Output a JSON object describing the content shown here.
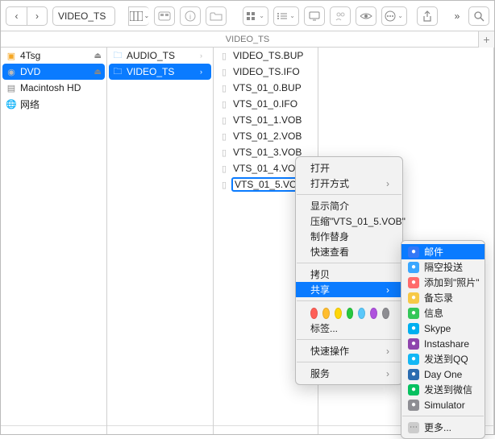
{
  "window_title": "VIDEO_TS",
  "path_title": "VIDEO_TS",
  "toolbar": {
    "back": "‹",
    "forward": "›",
    "more": "»"
  },
  "sidebar": {
    "items": [
      {
        "label": "4Tsg",
        "icon": "orange",
        "eject": true
      },
      {
        "label": "DVD",
        "icon": "disc",
        "eject": true,
        "selected": true
      },
      {
        "label": "Macintosh HD",
        "icon": "hd",
        "eject": false
      },
      {
        "label": "网络",
        "icon": "network",
        "eject": false
      }
    ]
  },
  "col2": {
    "items": [
      {
        "label": "AUDIO_TS",
        "folder": true,
        "disclosure": true
      },
      {
        "label": "VIDEO_TS",
        "folder": true,
        "disclosure": true,
        "selected": true
      }
    ]
  },
  "col3": {
    "items": [
      {
        "label": "VIDEO_TS.BUP"
      },
      {
        "label": "VIDEO_TS.IFO"
      },
      {
        "label": "VTS_01_0.BUP"
      },
      {
        "label": "VTS_01_0.IFO"
      },
      {
        "label": "VTS_01_1.VOB"
      },
      {
        "label": "VTS_01_2.VOB"
      },
      {
        "label": "VTS_01_3.VOB"
      },
      {
        "label": "VTS_01_4.VOB"
      },
      {
        "label": "VTS_01_5.VOB",
        "selected_box": true
      }
    ]
  },
  "context_menu": {
    "open": "打开",
    "open_with": "打开方式",
    "get_info": "显示简介",
    "compress": "压缩\"VTS_01_5.VOB\"",
    "make_alias": "制作替身",
    "quick_look": "快速查看",
    "copy": "拷贝",
    "share": "共享",
    "tags_label": "标签...",
    "quick_actions": "快速操作",
    "services": "服务",
    "tags": [
      "#ff5f57",
      "#ffbd2e",
      "#ffd60a",
      "#28c840",
      "#5ac8fa",
      "#af52de",
      "#8e8e93"
    ]
  },
  "share_menu": {
    "items": [
      {
        "label": "邮件",
        "color": "#3478f6",
        "selected": true
      },
      {
        "label": "隔空投送",
        "color": "#3aa7ff"
      },
      {
        "label": "添加到\"照片\"",
        "color": "#ff6b6b"
      },
      {
        "label": "备忘录",
        "color": "#f7c948"
      },
      {
        "label": "信息",
        "color": "#34c759"
      },
      {
        "label": "Skype",
        "color": "#00aff0"
      },
      {
        "label": "Instashare",
        "color": "#8e44ad"
      },
      {
        "label": "发送到QQ",
        "color": "#12b7f5"
      },
      {
        "label": "Day One",
        "color": "#2b6cb0"
      },
      {
        "label": "发送到微信",
        "color": "#07c160"
      },
      {
        "label": "Simulator",
        "color": "#8e8e93"
      }
    ],
    "more": "更多..."
  }
}
